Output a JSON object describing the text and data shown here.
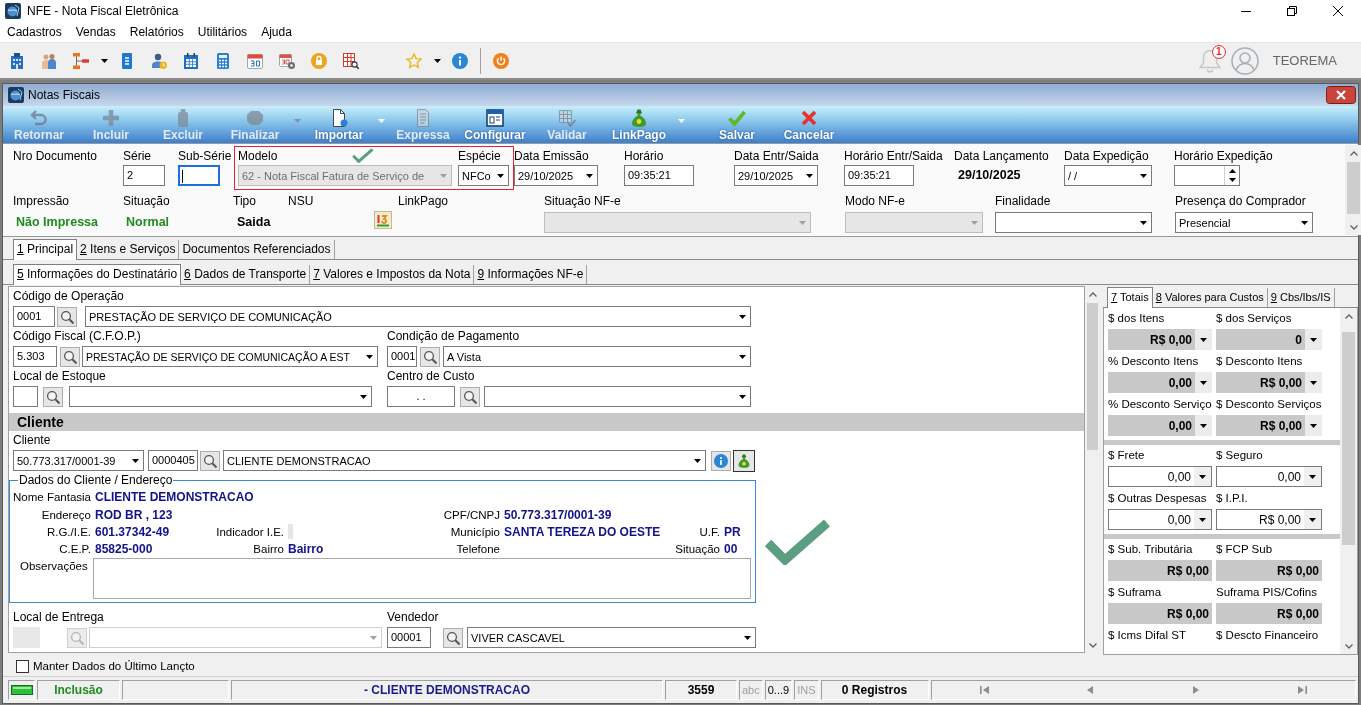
{
  "window": {
    "title": "NFE - Nota Fiscal Eletrônica"
  },
  "menu": [
    "Cadastros",
    "Vendas",
    "Relatórios",
    "Utilitários",
    "Ajuda"
  ],
  "toolbar": {
    "notifications": "1",
    "user": "TEOREMA"
  },
  "document_window": {
    "title": "Notas Fiscais",
    "commands": [
      {
        "label": "Retornar",
        "disabled": true,
        "dropdown": false
      },
      {
        "label": "Incluir",
        "disabled": true,
        "dropdown": false
      },
      {
        "label": "Excluir",
        "disabled": true,
        "dropdown": false
      },
      {
        "label": "Finalizar",
        "disabled": true,
        "dropdown": true
      },
      {
        "label": "Importar",
        "disabled": false,
        "dropdown": true
      },
      {
        "label": "Expressa",
        "disabled": true,
        "dropdown": false
      },
      {
        "label": "Configurar",
        "disabled": false,
        "dropdown": false
      },
      {
        "label": "Validar",
        "disabled": true,
        "dropdown": false
      },
      {
        "label": "LinkPago",
        "disabled": false,
        "dropdown": true
      },
      {
        "label": "Salvar",
        "disabled": false,
        "dropdown": false
      },
      {
        "label": "Cancelar",
        "disabled": false,
        "dropdown": false
      }
    ]
  },
  "header": {
    "row1": [
      {
        "kind": "label",
        "label": "Nro Documento"
      },
      {
        "kind": "input",
        "label": "Série",
        "value": "2",
        "focused": false
      },
      {
        "kind": "input",
        "label": "Sub-Série",
        "focused": true
      },
      {
        "kind": "group",
        "highlighted": true,
        "check_mark": true,
        "fields": [
          {
            "kind": "select",
            "label": "Modelo",
            "value": "62 - Nota Fiscal Fatura de Serviço de",
            "disabled": true
          },
          {
            "kind": "select",
            "label": "Espécie",
            "value": "NFCo",
            "disabled": false
          }
        ]
      },
      {
        "kind": "select",
        "label": "Data Emissão",
        "value": "29/10/2025",
        "disabled": false
      },
      {
        "kind": "input",
        "label": "Horário",
        "value": "09:35:21",
        "focused": false
      },
      {
        "kind": "select",
        "label": "Data Entr/Saida",
        "value": "29/10/2025",
        "disabled": false
      },
      {
        "kind": "input",
        "label": "Horário Entr/Saida",
        "value": "09:35:21",
        "focused": false
      },
      {
        "kind": "display",
        "label": "Data Lançamento",
        "value": "29/10/2025"
      },
      {
        "kind": "select",
        "label": "Data Expedição",
        "value": "/ /",
        "disabled": false
      },
      {
        "kind": "spin",
        "label": "Horário Expedição"
      }
    ],
    "row2": [
      {
        "kind": "status",
        "label": "Impressão",
        "value": "Não Impressa"
      },
      {
        "kind": "status",
        "label": "Situação",
        "value": "Normal"
      },
      {
        "kind": "display",
        "label": "Tipo",
        "value": "Saida"
      },
      {
        "kind": "label",
        "label": "NSU"
      },
      {
        "kind": "icon_button",
        "label": "LinkPago"
      },
      {
        "kind": "select",
        "label": "Situação NF-e",
        "disabled": true
      },
      {
        "kind": "select",
        "label": "Modo NF-e",
        "disabled": true
      },
      {
        "kind": "select",
        "label": "Finalidade",
        "disabled": false
      },
      {
        "kind": "select",
        "label": "Presença do Comprador",
        "value": "Presencial",
        "disabled": false
      }
    ]
  },
  "tabs": [
    {
      "label": "1 Principal",
      "selected": true,
      "hotkey": true
    },
    {
      "label": "2 Itens e Serviços",
      "selected": false,
      "hotkey": true
    },
    {
      "label": "Documentos Referenciados",
      "selected": false,
      "hotkey": false
    }
  ],
  "subtabs": [
    {
      "label": "5 Informações do Destinatário",
      "selected": true,
      "hotkey": true
    },
    {
      "label": "6 Dados de Transporte",
      "selected": false,
      "hotkey": true
    },
    {
      "label": "7 Valores e Impostos da Nota",
      "selected": false,
      "hotkey": true
    },
    {
      "label": "9 Informações NF-e",
      "selected": false,
      "hotkey": true
    }
  ],
  "main": {
    "operation": {
      "label": "Código de Operação",
      "code": "0001",
      "value": "PRESTAÇÃO DE SERVIÇO DE COMUNICAÇÃO"
    },
    "cfop": {
      "label": "Código Fiscal (C.F.O.P.)",
      "code": "5.303",
      "value": "PRESTAÇÃO DE SERVIÇO DE COMUNICAÇÃO A EST"
    },
    "payment": {
      "label": "Condição de Pagamento",
      "code": "0001",
      "value": "A Vista"
    },
    "stock": {
      "label": "Local de Estoque"
    },
    "cost_center": {
      "label": "Centro de Custo",
      "code": ". ."
    },
    "client_section": {
      "title": "Cliente"
    },
    "client": {
      "label": "Cliente",
      "document": "50.773.317/0001-39",
      "code": "0000405",
      "value": "CLIENTE DEMONSTRACAO"
    },
    "client_details": {
      "title": "Dados do Cliente / Endereço",
      "check_mark": true,
      "rows": [
        [
          {
            "label": "Nome Fantasia",
            "kind": "text",
            "value": "CLIENTE DEMONSTRACAO"
          }
        ],
        [
          {
            "label": "Endereço",
            "kind": "text",
            "value": "ROD BR , 123"
          },
          {
            "kind": "none"
          },
          {
            "label": "CPF/CNPJ",
            "kind": "text",
            "value": "50.773.317/0001-39"
          }
        ],
        [
          {
            "label": "R.G./I.E.",
            "kind": "text",
            "value": "601.37342-49"
          },
          {
            "label": "Indicador I.E.",
            "kind": "box"
          },
          {
            "label": "Município",
            "kind": "text",
            "value": "SANTA TEREZA DO OESTE"
          },
          {
            "label": "U.F.",
            "kind": "text",
            "value": "PR"
          }
        ],
        [
          {
            "label": "C.E.P.",
            "kind": "text",
            "value": "85825-000"
          },
          {
            "label": "Bairro",
            "kind": "text",
            "value": "Bairro"
          },
          {
            "label": "Telefone",
            "kind": "empty"
          },
          {
            "label": "Situação",
            "kind": "text",
            "value": "00"
          }
        ]
      ],
      "observations": {
        "label": "Observações"
      }
    },
    "delivery": {
      "label": "Local de Entrega",
      "disabled": true
    },
    "seller": {
      "label": "Vendedor",
      "code": "00001",
      "value": "VIVER CASCAVEL"
    }
  },
  "totals": {
    "tabs": [
      {
        "label": "7 Totais",
        "selected": true,
        "hotkey": true
      },
      {
        "label": "8 Valores para Custos",
        "selected": false,
        "hotkey": true
      },
      {
        "label": "9 Cbs/Ibs/IS",
        "selected": false,
        "hotkey": true
      }
    ],
    "sections": [
      {
        "rows": [
          [
            {
              "label": "$ dos Itens",
              "value": "R$ 0,00",
              "editable": false,
              "dropdown": true
            },
            {
              "label": "$ dos Serviços",
              "value": "0",
              "editable": false,
              "dropdown": true
            }
          ],
          [
            {
              "label": "% Desconto Itens",
              "value": "0,00",
              "editable": false,
              "dropdown": true
            },
            {
              "label": "$ Desconto Itens",
              "value": "R$ 0,00",
              "editable": false,
              "dropdown": true
            }
          ],
          [
            {
              "label": "% Desconto Serviço",
              "value": "0,00",
              "editable": false,
              "dropdown": true
            },
            {
              "label": "$ Desconto Serviços",
              "value": "R$ 0,00",
              "editable": false,
              "dropdown": true
            }
          ]
        ]
      },
      {
        "rows": [
          [
            {
              "label": "$ Frete",
              "value": "0,00",
              "editable": true,
              "dropdown": true
            },
            {
              "label": "$ Seguro",
              "value": "0,00",
              "editable": true,
              "dropdown": true
            }
          ],
          [
            {
              "label": "$ Outras Despesas",
              "value": "0,00",
              "editable": true,
              "dropdown": true
            },
            {
              "label": "$ I.P.I.",
              "value": "R$ 0,00",
              "editable": true,
              "dropdown": true
            }
          ]
        ]
      },
      {
        "rows": [
          [
            {
              "label": "$ Sub. Tributária",
              "value": "R$ 0,00",
              "editable": false,
              "dropdown": false
            },
            {
              "label": "$ FCP Sub",
              "value": "R$ 0,00",
              "editable": false,
              "dropdown": false
            }
          ],
          [
            {
              "label": "$ Suframa",
              "value": "R$ 0,00",
              "editable": false,
              "dropdown": false
            },
            {
              "label": "Suframa PIS/Cofins",
              "value": "R$ 0,00",
              "editable": false,
              "dropdown": false
            }
          ],
          [
            {
              "label": "$ Icms Difal ST"
            },
            {
              "label": "$ Descto Financeiro"
            }
          ]
        ]
      }
    ]
  },
  "keep_last": {
    "label": "Manter Dados do Último Lançto",
    "checked": false
  },
  "status_bar": {
    "mode": "Inclusão",
    "record": "- CLIENTE DEMONSTRACAO",
    "number": "3559",
    "indicators": [
      {
        "label": "abc",
        "active": false
      },
      {
        "label": "0...9",
        "active": true
      },
      {
        "label": "INS",
        "active": false
      }
    ],
    "records": "0 Registros"
  }
}
